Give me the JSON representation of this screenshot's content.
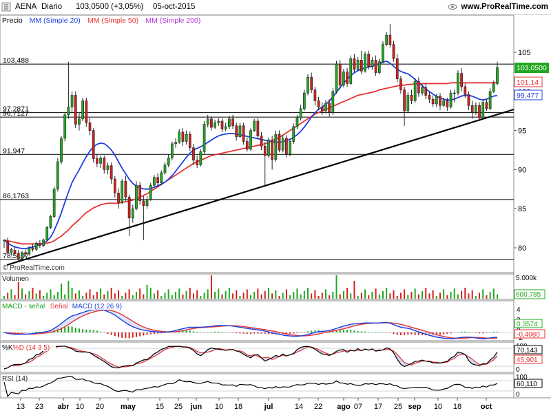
{
  "header": {
    "ticker": "AENA",
    "period": "Diario",
    "price_change": "103,0500 (+3,05%)",
    "date": "05-oct-2015",
    "site": "www.ProRealTime.com",
    "menu_icon": "menu-icon",
    "watch_icon": "eye-icon"
  },
  "colors": {
    "candle_up": "#22a822",
    "candle_down": "#d42020",
    "ma20": "#1a3fe0",
    "ma50": "#e83232",
    "ma200": "#b030d8",
    "support_line": "#000000",
    "level_line": "#000000",
    "panel_grid": "#cfd4da"
  },
  "price_panel": {
    "legend": [
      {
        "label": "Precio",
        "color": "#000000"
      },
      {
        "label": "MM (Simple 20)",
        "color": "#1a3fe0"
      },
      {
        "label": "MM (Simple 50)",
        "color": "#e83232"
      },
      {
        "label": "MM (Simple 200)",
        "color": "#b030d8"
      }
    ],
    "copyright": "© ProRealTime.com",
    "levels": [
      "103,488",
      "97,2871",
      "96,7127",
      "91,947",
      "86,1763",
      "78,5107"
    ],
    "ticks": [
      "105",
      "100",
      "95",
      "90",
      "85",
      "80"
    ],
    "price_label": "103,0500",
    "ma50_label": "101,14",
    "ma20_label": "99,477"
  },
  "volume_panel": {
    "title": "Volumen",
    "tick": "5.000k",
    "value": "600.785"
  },
  "macd_panel": {
    "legend": [
      {
        "label": "MACD - señal",
        "color": "#1aa21a"
      },
      {
        "label": "Señal",
        "color": "#e83232"
      },
      {
        "label": "MACD (12 26 9)",
        "color": "#1a3fe0"
      }
    ],
    "ticks": [
      "4",
      "2",
      "0",
      "-2"
    ],
    "value_pos": "0,3574",
    "value_neg": "-0,4080"
  },
  "stoch_panel": {
    "legend": [
      {
        "label": "%K",
        "color": "#000000"
      },
      {
        "label": "%D (14 3 5)",
        "color": "#e83232"
      }
    ],
    "ticks": [
      "100",
      "0"
    ],
    "k_value": "70,143",
    "d_value": "45,901"
  },
  "rsi_panel": {
    "title": "RSI (14)",
    "ticks": [
      "100",
      "0"
    ],
    "value": "60,110"
  },
  "x_axis": {
    "labels": [
      "13",
      "23",
      "abr",
      "10",
      "20",
      "may",
      "15",
      "25",
      "jun",
      "10",
      "18",
      "jul",
      "14",
      "22",
      "ago",
      "07",
      "17",
      "25",
      "sep",
      "10",
      "18",
      "oct"
    ]
  },
  "chart_data": {
    "type": "candlestick",
    "y_range": [
      77.3,
      108.6
    ],
    "period": "Diario",
    "candles": [
      [
        81,
        80.5,
        81.0,
        80.0,
        81.0
      ],
      [
        80.8,
        81.2,
        79.4,
        81.3,
        79.2
      ],
      [
        79.4,
        79.6,
        79.8,
        80.0,
        79.0
      ],
      [
        79.7,
        80.0,
        79.3,
        80.2,
        79.0
      ],
      [
        79.3,
        79.5,
        78.6,
        79.7,
        78.3
      ],
      [
        78.6,
        78.9,
        79.4,
        79.6,
        78.4
      ],
      [
        79.4,
        79.5,
        79.2,
        79.8,
        78.8
      ],
      [
        79.2,
        79.4,
        80.0,
        80.2,
        79.0
      ],
      [
        80.0,
        80.2,
        79.8,
        80.5,
        79.5
      ],
      [
        79.8,
        80.0,
        80.6,
        80.8,
        79.6
      ],
      [
        80.6,
        80.8,
        80.3,
        81.0,
        80.0
      ],
      [
        80.3,
        80.4,
        81.0,
        81.2,
        80.1
      ],
      [
        81.0,
        81.1,
        82.6,
        82.8,
        80.8
      ],
      [
        82.6,
        82.8,
        84.0,
        84.2,
        82.4
      ],
      [
        84.0,
        84.2,
        87.5,
        87.8,
        83.8
      ],
      [
        87.5,
        88.0,
        91.0,
        91.5,
        87.2
      ],
      [
        91.0,
        91.5,
        94.0,
        94.3,
        90.7
      ],
      [
        94.0,
        94.5,
        97.0,
        97.3,
        93.6
      ],
      [
        97.0,
        97.5,
        98.0,
        103.8,
        96.5
      ],
      [
        98.0,
        98.2,
        99.5,
        100.0,
        97.2
      ],
      [
        99.5,
        99.8,
        95.8,
        100.0,
        95.3
      ],
      [
        95.8,
        96.0,
        96.5,
        97.3,
        95.0
      ],
      [
        96.5,
        96.8,
        98.8,
        99.2,
        96.2
      ],
      [
        98.8,
        99.0,
        96.0,
        99.2,
        95.5
      ],
      [
        96.0,
        96.2,
        95.0,
        96.6,
        94.4
      ],
      [
        95.0,
        95.1,
        91.4,
        95.3,
        90.9
      ],
      [
        91.4,
        91.5,
        90.8,
        92.0,
        90.3
      ],
      [
        90.8,
        91.0,
        91.5,
        91.8,
        90.2
      ],
      [
        91.5,
        91.6,
        90.0,
        91.8,
        89.5
      ],
      [
        90.0,
        90.2,
        90.5,
        90.9,
        89.4
      ],
      [
        90.5,
        90.7,
        88.8,
        90.9,
        88.2
      ],
      [
        88.8,
        89.0,
        87.0,
        89.2,
        86.4
      ],
      [
        87.0,
        87.2,
        85.8,
        87.6,
        85.0
      ],
      [
        85.8,
        86.0,
        88.5,
        88.8,
        85.6
      ],
      [
        88.5,
        88.6,
        86.5,
        89.2,
        86.0
      ],
      [
        86.5,
        86.6,
        83.8,
        86.8,
        81.5
      ],
      [
        83.8,
        84.0,
        85.0,
        85.5,
        83.2
      ],
      [
        85.0,
        85.3,
        88.0,
        88.5,
        84.8
      ],
      [
        88.0,
        88.2,
        86.0,
        88.4,
        85.5
      ],
      [
        86.0,
        86.2,
        85.4,
        86.6,
        81.0
      ],
      [
        85.4,
        85.6,
        86.2,
        86.6,
        85.0
      ],
      [
        86.2,
        86.5,
        88.0,
        88.3,
        86.0
      ],
      [
        88.0,
        88.2,
        89.0,
        89.3,
        87.8
      ],
      [
        89.0,
        89.2,
        88.3,
        89.5,
        87.8
      ],
      [
        88.3,
        88.5,
        89.6,
        89.9,
        88.0
      ],
      [
        89.6,
        89.8,
        90.6,
        91.0,
        89.3
      ],
      [
        90.6,
        90.8,
        91.5,
        92.0,
        90.3
      ],
      [
        91.5,
        91.7,
        93.3,
        93.6,
        91.2
      ],
      [
        93.3,
        93.5,
        93.5,
        94.0,
        92.8
      ],
      [
        93.5,
        93.8,
        94.8,
        95.2,
        93.3
      ],
      [
        94.8,
        95.1,
        93.6,
        95.3,
        93.0
      ],
      [
        93.6,
        93.8,
        94.5,
        95.0,
        93.2
      ],
      [
        94.5,
        94.6,
        92.8,
        94.9,
        92.4
      ],
      [
        92.8,
        93.0,
        91.2,
        93.3,
        90.6
      ],
      [
        91.2,
        91.4,
        90.6,
        91.8,
        90.2
      ],
      [
        90.6,
        90.8,
        92.3,
        92.6,
        90.4
      ],
      [
        92.3,
        92.5,
        95.8,
        96.2,
        92.0
      ],
      [
        95.8,
        96.0,
        96.5,
        97.0,
        95.4
      ],
      [
        96.5,
        96.7,
        95.4,
        96.8,
        95.0
      ],
      [
        95.4,
        95.6,
        96.0,
        96.4,
        95.2
      ],
      [
        96.0,
        96.1,
        96.2,
        96.6,
        95.6
      ],
      [
        96.2,
        96.3,
        95.2,
        96.6,
        94.8
      ],
      [
        95.2,
        95.4,
        95.5,
        96.0,
        94.9
      ],
      [
        95.5,
        95.7,
        96.5,
        96.9,
        95.2
      ],
      [
        96.5,
        96.7,
        95.6,
        97.0,
        95.2
      ],
      [
        95.6,
        95.8,
        94.2,
        96.0,
        93.7
      ],
      [
        94.2,
        94.4,
        95.6,
        96.0,
        94.0
      ],
      [
        95.6,
        95.8,
        93.6,
        96.0,
        93.2
      ],
      [
        93.6,
        93.8,
        92.6,
        94.1,
        92.3
      ],
      [
        92.6,
        92.8,
        95.0,
        95.3,
        92.4
      ],
      [
        95.0,
        95.2,
        96.2,
        96.5,
        94.8
      ],
      [
        96.2,
        96.4,
        94.3,
        96.6,
        94.0
      ],
      [
        94.3,
        94.4,
        93.0,
        94.8,
        92.5
      ],
      [
        93.0,
        93.2,
        91.8,
        93.5,
        88.0
      ],
      [
        91.8,
        92.0,
        93.8,
        94.1,
        91.5
      ],
      [
        93.8,
        94.0,
        91.3,
        94.3,
        90.0
      ],
      [
        91.3,
        91.5,
        94.5,
        95.0,
        91.0
      ],
      [
        94.5,
        94.7,
        92.5,
        95.0,
        92.2
      ],
      [
        92.5,
        92.6,
        94.0,
        94.4,
        92.2
      ],
      [
        94.0,
        94.2,
        92.0,
        94.4,
        91.6
      ],
      [
        92.0,
        92.2,
        93.6,
        93.9,
        91.7
      ],
      [
        93.6,
        93.8,
        95.5,
        95.9,
        93.3
      ],
      [
        95.5,
        95.7,
        96.6,
        97.0,
        95.2
      ],
      [
        96.6,
        96.8,
        97.8,
        98.3,
        96.3
      ],
      [
        97.8,
        98.0,
        99.8,
        100.2,
        97.5
      ],
      [
        99.8,
        100.0,
        101.8,
        102.2,
        99.5
      ],
      [
        101.8,
        102.0,
        100.2,
        102.4,
        99.8
      ],
      [
        100.2,
        100.4,
        98.8,
        100.6,
        98.2
      ],
      [
        98.8,
        99.0,
        98.0,
        99.3,
        97.6
      ],
      [
        98.0,
        98.2,
        97.5,
        98.6,
        97.0
      ],
      [
        97.5,
        97.7,
        98.5,
        98.9,
        97.2
      ],
      [
        98.5,
        98.7,
        97.3,
        99.0,
        96.8
      ],
      [
        97.3,
        97.5,
        100.0,
        100.4,
        97.0
      ],
      [
        100.0,
        100.2,
        103.5,
        103.9,
        99.7
      ],
      [
        103.5,
        103.7,
        100.8,
        104.0,
        100.3
      ],
      [
        100.8,
        101.0,
        102.5,
        102.9,
        100.5
      ],
      [
        102.5,
        102.7,
        101.0,
        103.0,
        100.6
      ],
      [
        101.0,
        101.2,
        104.2,
        104.6,
        100.8
      ],
      [
        104.2,
        104.4,
        102.8,
        104.8,
        102.4
      ],
      [
        102.8,
        103.0,
        104.0,
        104.4,
        102.6
      ],
      [
        104.0,
        104.2,
        102.6,
        105.2,
        102.2
      ],
      [
        102.6,
        102.8,
        104.8,
        105.1,
        102.4
      ],
      [
        104.8,
        105.0,
        103.2,
        105.2,
        102.8
      ],
      [
        103.2,
        103.4,
        104.0,
        104.4,
        102.8
      ],
      [
        104.0,
        104.2,
        102.4,
        104.6,
        102.0
      ],
      [
        102.4,
        102.6,
        103.8,
        104.2,
        102.2
      ],
      [
        103.8,
        104.0,
        106.0,
        106.4,
        103.6
      ],
      [
        106.0,
        106.2,
        107.2,
        107.6,
        105.8
      ],
      [
        107.2,
        107.4,
        106.0,
        108.6,
        105.6
      ],
      [
        106.0,
        106.2,
        104.2,
        106.5,
        103.8
      ],
      [
        104.2,
        104.4,
        101.6,
        104.8,
        101.2
      ],
      [
        101.6,
        101.8,
        100.2,
        102.0,
        99.7
      ],
      [
        100.2,
        100.4,
        97.5,
        100.6,
        95.6
      ],
      [
        97.5,
        97.7,
        99.5,
        99.9,
        97.2
      ],
      [
        99.5,
        99.7,
        98.8,
        100.2,
        98.4
      ],
      [
        98.8,
        99.0,
        101.3,
        101.7,
        98.5
      ],
      [
        101.3,
        101.5,
        99.8,
        101.8,
        99.3
      ],
      [
        99.8,
        100.0,
        100.5,
        100.9,
        99.5
      ],
      [
        100.5,
        100.7,
        99.5,
        101.0,
        99.0
      ],
      [
        99.5,
        99.7,
        99.0,
        100.0,
        98.5
      ],
      [
        99.0,
        99.2,
        98.4,
        99.5,
        98.0
      ],
      [
        98.4,
        98.6,
        99.4,
        99.7,
        98.0
      ],
      [
        99.4,
        99.6,
        98.2,
        99.8,
        97.6
      ],
      [
        98.2,
        98.4,
        98.8,
        99.2,
        98.0
      ],
      [
        98.8,
        99.0,
        98.0,
        99.2,
        97.5
      ],
      [
        98.0,
        98.2,
        99.8,
        100.2,
        97.8
      ],
      [
        99.8,
        100.0,
        99.8,
        100.2,
        98.6
      ],
      [
        99.8,
        100.0,
        102.3,
        102.7,
        99.5
      ],
      [
        102.3,
        102.5,
        100.6,
        103.0,
        100.0
      ],
      [
        100.6,
        100.8,
        99.6,
        101.0,
        99.2
      ],
      [
        99.6,
        99.8,
        98.2,
        100.0,
        97.6
      ],
      [
        98.2,
        98.4,
        97.3,
        98.8,
        96.5
      ],
      [
        97.3,
        97.5,
        98.2,
        98.6,
        97.0
      ],
      [
        98.2,
        98.4,
        96.6,
        98.6,
        96.2
      ],
      [
        96.6,
        96.8,
        98.6,
        99.0,
        96.4
      ],
      [
        98.6,
        98.8,
        97.8,
        99.0,
        97.5
      ],
      [
        97.8,
        98.0,
        100.0,
        100.4,
        97.6
      ],
      [
        100.0,
        100.2,
        101.0,
        101.4,
        99.8
      ],
      [
        101.0,
        101.2,
        103.05,
        103.8,
        100.8
      ]
    ],
    "ma20": [
      81.0,
      80.6,
      80.3,
      80.1,
      80.0,
      79.9,
      79.9,
      80.0,
      80.1,
      80.3,
      80.4,
      80.6,
      80.9,
      81.4,
      82.3,
      83.4,
      84.6,
      86.0,
      87.3,
      88.5,
      89.3,
      90.1,
      91.0,
      91.8,
      92.5,
      93.0,
      93.3,
      93.4,
      93.3,
      92.9,
      92.4,
      91.7,
      90.8,
      90.0,
      89.3,
      88.6,
      88.1,
      87.8,
      87.6,
      87.5,
      87.5,
      87.6,
      87.8,
      88.0,
      88.2,
      88.5,
      88.9,
      89.4,
      90.0,
      90.6,
      91.2,
      91.8,
      92.3,
      92.6,
      92.8,
      93.0,
      93.3,
      93.6,
      93.9,
      94.2,
      94.4,
      94.5,
      94.6,
      94.6,
      94.6,
      94.5,
      94.4,
      94.3,
      94.2,
      94.1,
      94.0,
      93.9,
      93.8,
      93.7,
      93.6,
      93.5,
      93.5,
      93.5,
      93.6,
      93.8,
      94.0,
      94.3,
      94.7,
      95.2,
      95.8,
      96.5,
      97.1,
      97.6,
      97.9,
      98.2,
      98.6,
      99.1,
      99.7,
      100.3,
      100.9,
      101.4,
      101.9,
      102.3,
      102.6,
      102.8,
      103.0,
      103.1,
      103.2,
      103.3,
      103.5,
      103.7,
      103.9,
      103.7,
      103.3,
      102.9,
      102.6,
      102.4,
      102.3,
      102.0,
      101.6,
      101.2,
      100.8,
      100.4,
      100.0,
      99.7,
      99.4,
      99.2,
      99.0,
      98.9,
      98.9,
      99.0,
      99.2,
      99.4,
      99.5,
      99.5,
      99.4,
      99.2,
      99.0,
      98.9,
      99.0,
      99.2,
      99.4,
      99.477
    ],
    "ma50": [
      81.0,
      80.9,
      80.8,
      80.7,
      80.6,
      80.5,
      80.5,
      80.5,
      80.5,
      80.5,
      80.5,
      80.5,
      80.6,
      80.7,
      80.9,
      81.2,
      81.5,
      81.9,
      82.3,
      82.8,
      83.2,
      83.6,
      84.1,
      84.5,
      84.8,
      85.1,
      85.3,
      85.5,
      85.6,
      85.7,
      85.7,
      85.7,
      85.7,
      85.8,
      85.9,
      86.0,
      86.1,
      86.3,
      86.5,
      86.7,
      86.9,
      87.2,
      87.5,
      87.8,
      88.1,
      88.4,
      88.7,
      89.0,
      89.3,
      89.6,
      89.9,
      90.2,
      90.5,
      90.8,
      91.0,
      91.2,
      91.4,
      91.6,
      91.8,
      91.9,
      92.0,
      92.1,
      92.2,
      92.3,
      92.4,
      92.5,
      92.6,
      92.7,
      92.8,
      92.9,
      93.0,
      93.1,
      93.2,
      93.3,
      93.5,
      93.7,
      93.9,
      94.1,
      94.4,
      94.7,
      95.0,
      95.3,
      95.6,
      95.9,
      96.2,
      96.5,
      96.8,
      97.1,
      97.3,
      97.5,
      97.7,
      97.9,
      98.1,
      98.3,
      98.5,
      98.7,
      98.9,
      99.1,
      99.3,
      99.5,
      99.6,
      99.7,
      99.8,
      99.9,
      100.0,
      100.2,
      100.3,
      100.4,
      100.5,
      100.6,
      100.7,
      100.8,
      100.8,
      100.9,
      100.9,
      101.0,
      101.0,
      101.0,
      101.0,
      101.0,
      101.0,
      101.0,
      101.0,
      101.0,
      101.0,
      101.1,
      101.1,
      101.1,
      101.1,
      101.1,
      101.1,
      101.1,
      101.1,
      101.1,
      101.1,
      101.1,
      101.1,
      101.1,
      101.14
    ]
  }
}
